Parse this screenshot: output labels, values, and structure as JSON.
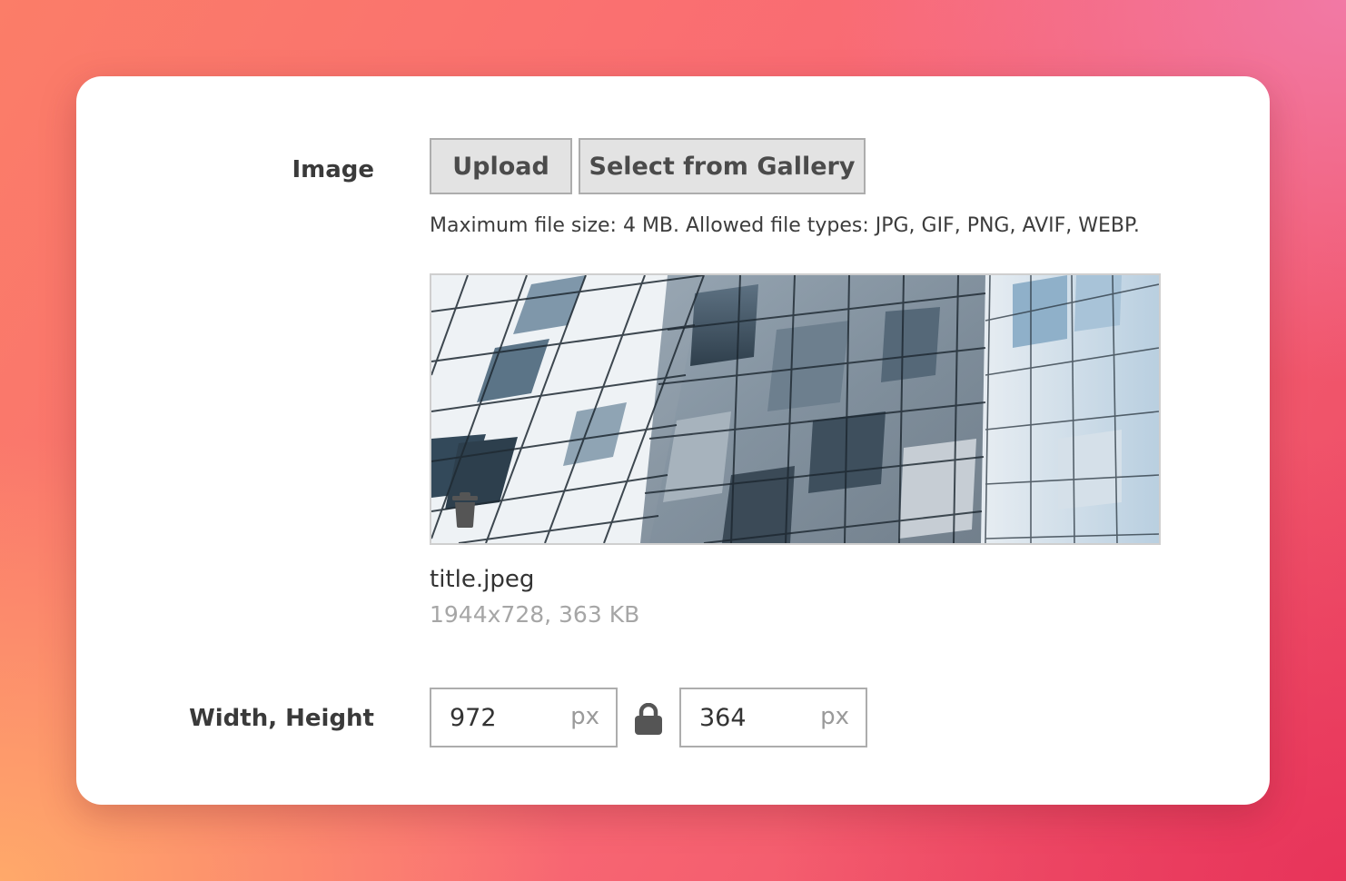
{
  "image_field": {
    "label": "Image",
    "upload_label": "Upload",
    "gallery_label": "Select from Gallery",
    "hint": "Maximum file size: 4 MB. Allowed file types: JPG, GIF, PNG, AVIF, WEBP.",
    "file_name": "title.jpeg",
    "file_meta": "1944x728, 363 KB",
    "preview_icon": "building-glass-facade-image",
    "delete_icon": "trash-icon"
  },
  "dimensions": {
    "label": "Width, Height",
    "width_value": "972",
    "height_value": "364",
    "unit": "px",
    "lock_icon": "lock-icon"
  },
  "colors": {
    "button_bg": "#e3e3e3",
    "button_border": "#adadad",
    "label_text": "#3a3a3a",
    "muted_text": "#a6a6a6"
  }
}
